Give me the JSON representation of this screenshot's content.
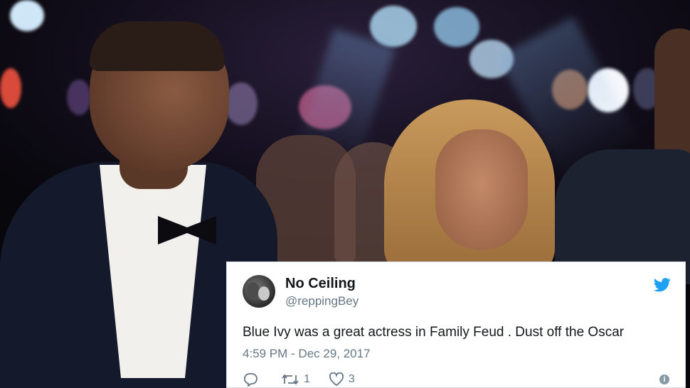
{
  "tweet": {
    "name": "No Ceiling",
    "handle": "@reppingBey",
    "text": "Blue Ivy was a great actress in Family Feud . Dust off the Oscar",
    "timestamp": "4:59 PM - Dec 29, 2017",
    "retweets": "1",
    "likes": "3",
    "icons": [
      "twitter-bird-icon",
      "reply-icon",
      "retweet-icon",
      "like-icon",
      "info-icon"
    ],
    "colors": {
      "twitter_blue": "#1da1f2",
      "meta_gray": "#657786",
      "text": "#14171a"
    }
  }
}
